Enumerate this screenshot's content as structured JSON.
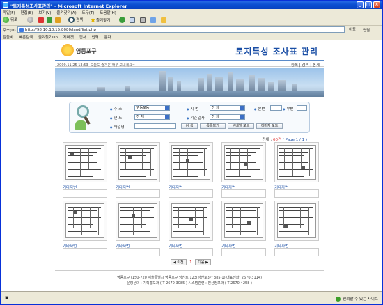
{
  "window": {
    "title": "\"토지특성조사표관리\" - Microsoft Internet Explorer",
    "minimize_glyph": "_",
    "maximize_glyph": "□",
    "close_glyph": "×"
  },
  "menu": [
    "파일(F)",
    "편집(E)",
    "보기(V)",
    "즐겨찾기(A)",
    "도구(T)",
    "도움말(H)"
  ],
  "toolbar": {
    "back": "뒤로",
    "search": "검색",
    "favorites": "즐겨찾기"
  },
  "address": {
    "label": "주소(D)",
    "url": "http://98.10.10.15:8080/land/list.php",
    "go": "이동",
    "links": "연결"
  },
  "links_bar": [
    "알툴바",
    "빠른검색",
    "즐겨찾기On",
    "지마켓",
    "캡처",
    "번역",
    "문자"
  ],
  "page": {
    "brand": "영등포구",
    "title": "토지특성 조사표 관리",
    "datetime": "2009.11.25 13:53",
    "greeting": "오늘도 즐거운 하루 보내세요~",
    "topnav": "등록 | 검색 | 통계"
  },
  "search": {
    "dong_label": "주 소",
    "dong_value": "영등포동",
    "jibeon_label": "지 번",
    "jibeon_value": "전 체",
    "bonbeon_label": "본번",
    "bubeon_label": "부번",
    "year_label": "연 도",
    "year_value": "전 체",
    "base_label": "기준일자",
    "base_value": "전 체",
    "file_label": "파일명",
    "search_btn": "검 색",
    "list_btn": "목록보기",
    "thumb_btn": "썸네일 모드",
    "image_btn": "이미지 모드"
  },
  "results": {
    "prefix": "전체 :",
    "count": "60건",
    "page": "( Page 1 / 1 )"
  },
  "cards": [
    {
      "caption": "기타자번"
    },
    {
      "caption": "기타자번"
    },
    {
      "caption": "기타자번"
    },
    {
      "caption": "기타자번"
    },
    {
      "caption": "기타자번"
    },
    {
      "caption": "기타자번"
    },
    {
      "caption": "기타자번"
    },
    {
      "caption": "기타자번"
    },
    {
      "caption": "기타자번"
    },
    {
      "caption": "기타자번"
    }
  ],
  "pager": {
    "prev": "◀ 이전",
    "current": "1",
    "next": "다음 ▶"
  },
  "footer": {
    "line1": "영등포구 (150-720 서울특별시 영등포구 당산로 123(당산로3가 385-1) 대표전화: 2670-3114)",
    "line2": "운영문의 : 기획홍보과 ( T 2670-3085 ) 시스템관련 : 전산정보과 ( T 2670-4258 )"
  },
  "status": {
    "zone": "신뢰할 수 있는 사이트"
  }
}
